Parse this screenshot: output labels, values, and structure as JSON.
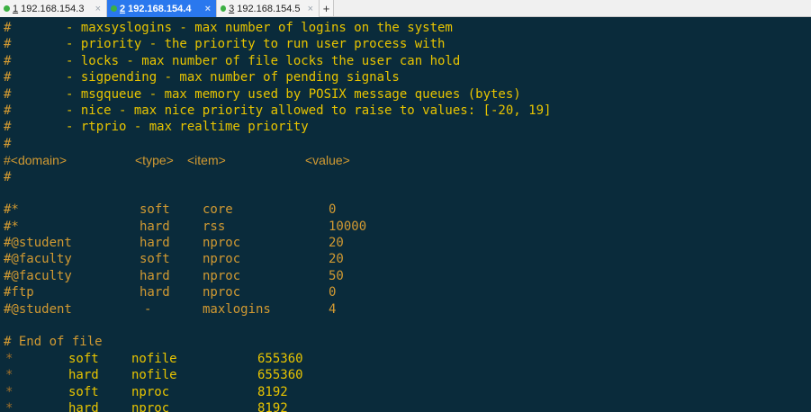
{
  "tabs": [
    {
      "num": "1",
      "label": " 192.168.154.3",
      "close": "×",
      "active": false
    },
    {
      "num": "2",
      "label": " 192.168.154.4",
      "close": "×",
      "active": true
    },
    {
      "num": "3",
      "label": " 192.168.154.5",
      "close": "×",
      "active": false
    }
  ],
  "add_tab": "+",
  "terminal": {
    "comment_lines": [
      {
        "hash": "#",
        "text": "- maxsyslogins - max number of logins on the system"
      },
      {
        "hash": "#",
        "text": "- priority - the priority to run user process with"
      },
      {
        "hash": "#",
        "text": "- locks - max number of file locks the user can hold"
      },
      {
        "hash": "#",
        "text": "- sigpending - max number of pending signals"
      },
      {
        "hash": "#",
        "text": "- msgqueue - max memory used by POSIX message queues (bytes)"
      },
      {
        "hash": "#",
        "text": "- nice - max nice priority allowed to raise to values: [-20, 19]"
      },
      {
        "hash": "#",
        "text": "- rtprio - max realtime priority"
      },
      {
        "hash": "#",
        "text": ""
      }
    ],
    "header": {
      "domain": "#<domain>",
      "type": "<type>",
      "item": "<item>",
      "value": "<value>"
    },
    "hash_after_header": "#",
    "example_rows": [
      {
        "domain": "#*",
        "type": "soft",
        "item": "core",
        "value": "0"
      },
      {
        "domain": "#*",
        "type": "hard",
        "item": "rss",
        "value": "10000"
      },
      {
        "domain": "#@student",
        "type": "hard",
        "item": "nproc",
        "value": "20"
      },
      {
        "domain": "#@faculty",
        "type": "soft",
        "item": "nproc",
        "value": "20"
      },
      {
        "domain": "#@faculty",
        "type": "hard",
        "item": "nproc",
        "value": "50"
      },
      {
        "domain": "#ftp",
        "type": "hard",
        "item": "nproc",
        "value": "0"
      },
      {
        "domain": "#@student",
        "type": "-",
        "item": "maxlogins",
        "value": "4"
      }
    ],
    "end_comment": "# End of file",
    "rules": [
      {
        "domain": "*",
        "type": "soft",
        "item": "nofile",
        "value": "655360"
      },
      {
        "domain": "*",
        "type": "hard",
        "item": "nofile",
        "value": "655360"
      },
      {
        "domain": "*",
        "type": "soft",
        "item": "nproc",
        "value": "8192"
      },
      {
        "domain": "*",
        "type": "hard",
        "item": "nproc",
        "value": "8192"
      }
    ]
  },
  "colors": {
    "background": "#0a2b3b",
    "comment": "#d29a32",
    "text": "#e8c400",
    "active_tab": "#2a78ee",
    "status_dot": "#3cb043"
  }
}
